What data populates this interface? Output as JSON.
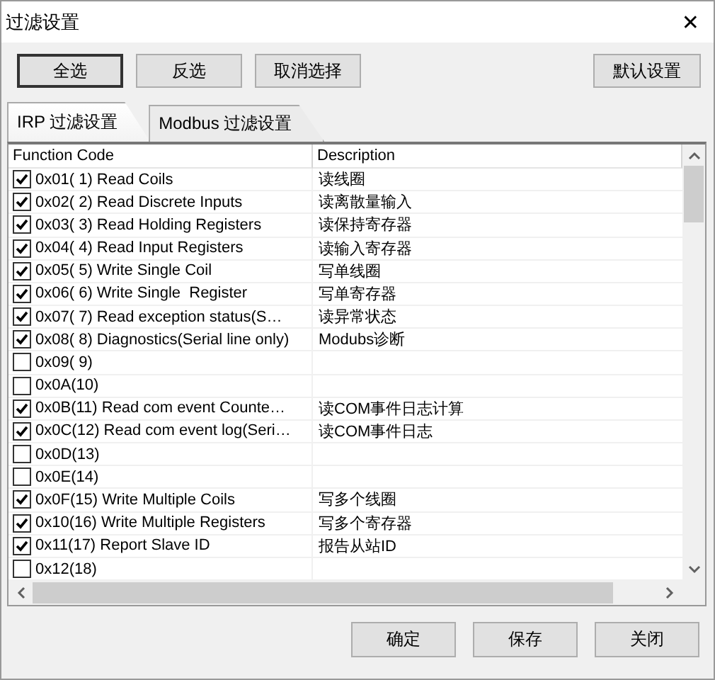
{
  "window": {
    "title": "过滤设置",
    "close": "✕"
  },
  "toolbar": [
    {
      "label": "全选",
      "default": true
    },
    {
      "label": "反选",
      "default": false
    },
    {
      "label": "取消选择",
      "default": false
    },
    {
      "label": "默认设置",
      "default": false
    }
  ],
  "tabs": [
    {
      "label": "IRP 过滤设置",
      "selected": true
    },
    {
      "label": "Modbus 过滤设置",
      "selected": false
    }
  ],
  "table": {
    "columns": [
      "Function Code",
      "Description"
    ],
    "rows": [
      {
        "code": "0x01( 1) Read Coils",
        "description": "读线圈",
        "checked": true
      },
      {
        "code": "0x02( 2) Read Discrete Inputs",
        "description": "读离散量输入",
        "checked": true
      },
      {
        "code": "0x03( 3) Read Holding Registers",
        "description": "读保持寄存器",
        "checked": true
      },
      {
        "code": "0x04( 4) Read Input Registers",
        "description": "读输入寄存器",
        "checked": true
      },
      {
        "code": "0x05( 5) Write Single Coil",
        "description": "写单线圈",
        "checked": true
      },
      {
        "code": "0x06( 6) Write Single  Register",
        "description": "写单寄存器",
        "checked": true
      },
      {
        "code": "0x07( 7) Read exception status(S…",
        "description": "读异常状态",
        "checked": true
      },
      {
        "code": "0x08( 8) Diagnostics(Serial line only)",
        "description": "Modubs诊断",
        "checked": true
      },
      {
        "code": "0x09( 9)",
        "checked": false
      },
      {
        "code": "0x0A(10)",
        "checked": false
      },
      {
        "code": "0x0B(11) Read com event Counte…",
        "description": "读COM事件日志计算",
        "checked": true
      },
      {
        "code": "0x0C(12) Read com event log(Seri…",
        "description": "读COM事件日志",
        "checked": true
      },
      {
        "code": "0x0D(13)",
        "checked": false
      },
      {
        "code": "0x0E(14)",
        "checked": false
      },
      {
        "code": "0x0F(15) Write Multiple Coils",
        "description": "写多个线圈",
        "checked": true
      },
      {
        "code": "0x10(16) Write Multiple Registers",
        "description": "写多个寄存器",
        "checked": true
      },
      {
        "code": "0x11(17) Report Slave ID",
        "description": "报告从站ID",
        "checked": true
      },
      {
        "code": "0x12(18)",
        "checked": false
      }
    ]
  },
  "buttons": [
    "确定",
    "保存",
    "关闭"
  ]
}
